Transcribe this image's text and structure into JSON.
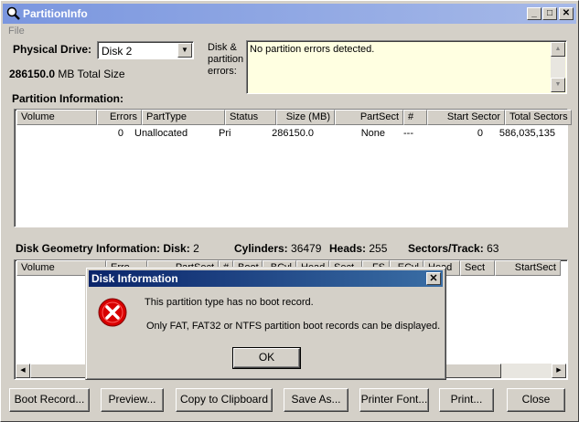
{
  "window": {
    "title": "PartitionInfo",
    "menu": [
      "File"
    ],
    "controls": {
      "minimize": "_",
      "maximize": "□",
      "close": "✕"
    }
  },
  "physical_drive": {
    "label": "Physical Drive:",
    "selected": "Disk 2",
    "total_size_value": "286150.0",
    "total_size_suffix": "MB Total Size"
  },
  "errors": {
    "label": "Disk & partition errors:",
    "text": "No partition errors detected."
  },
  "partition_info": {
    "heading": "Partition Information:",
    "columns": [
      "Volume",
      "Errors",
      "PartType",
      "Status",
      "Size (MB)",
      "PartSect",
      "#",
      "Start Sector",
      "Total Sectors"
    ],
    "rows": [
      [
        "",
        "0",
        "Unallocated",
        "Pri",
        "286150.0",
        "None",
        "---",
        "0",
        "586,035,135"
      ]
    ]
  },
  "geometry": {
    "heading": "Disk Geometry Information:",
    "disk_label": "Disk:",
    "disk_value": "2",
    "cylinders_label": "Cylinders:",
    "cylinders_value": "36479",
    "heads_label": "Heads:",
    "heads_value": "255",
    "sectors_label": "Sectors/Track:",
    "sectors_value": "63",
    "columns": [
      "Volume",
      "Erro",
      "PartSect",
      "#",
      "Boot",
      "BCyl",
      "Head",
      "Sect",
      "FS",
      "ECyl",
      "Head",
      "Sect",
      "StartSect"
    ]
  },
  "buttons": {
    "boot_record": "Boot Record...",
    "preview": "Preview...",
    "copy": "Copy to Clipboard",
    "save_as": "Save As...",
    "printer_font": "Printer Font...",
    "print": "Print...",
    "close": "Close"
  },
  "dialog": {
    "title": "Disk Information",
    "line1": "This partition type has no boot record.",
    "line2": "Only FAT, FAT32 or NTFS partition boot records can be displayed.",
    "ok": "OK",
    "close_glyph": "✕",
    "icon": "error-icon"
  }
}
